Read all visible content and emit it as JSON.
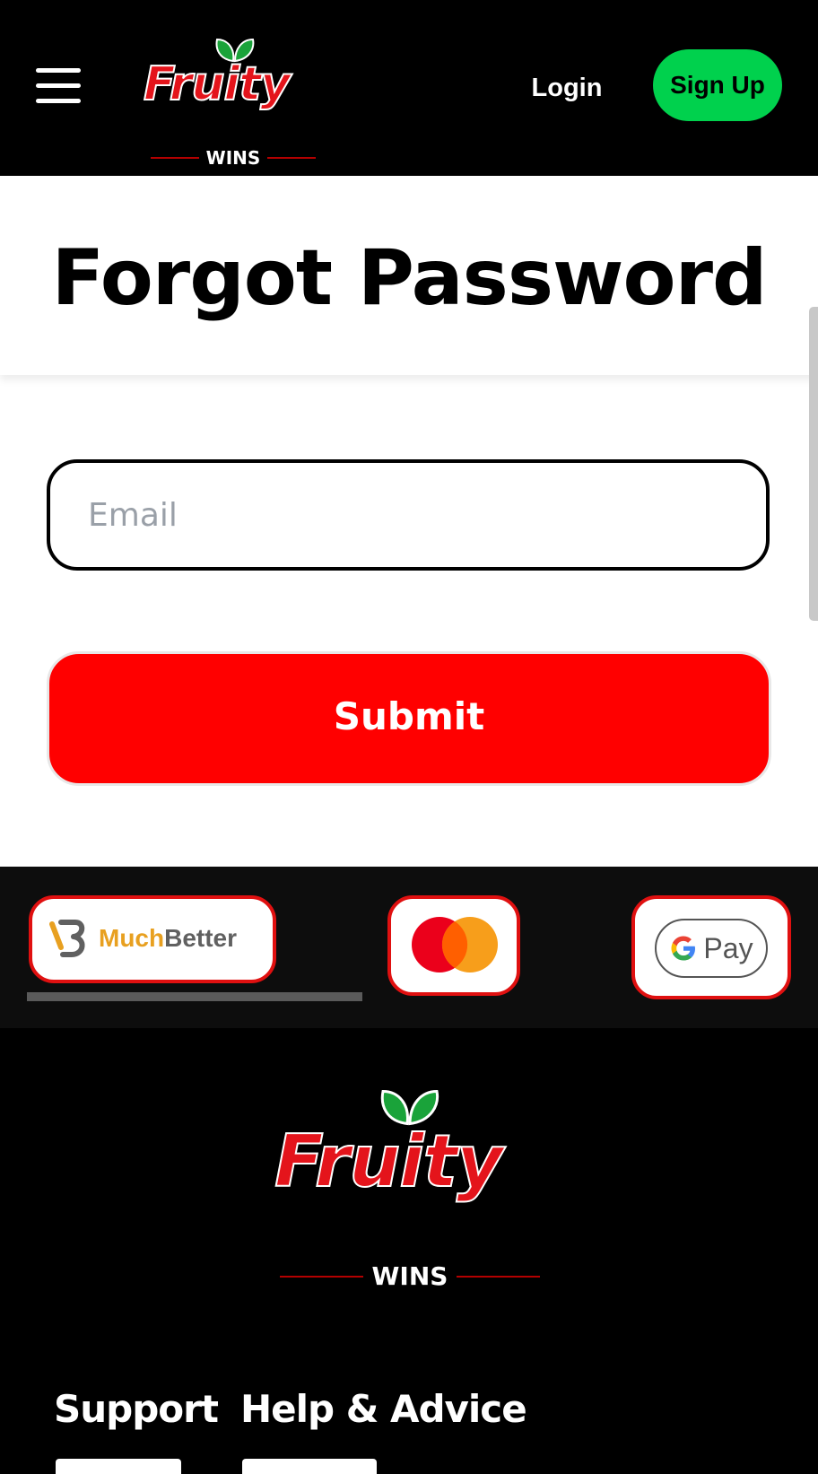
{
  "header": {
    "logo": {
      "word": "Fruity",
      "sub": "WINS"
    },
    "login_label": "Login",
    "signup_label": "Sign Up"
  },
  "main": {
    "title": "Forgot Password",
    "email_placeholder": "Email",
    "email_value": "",
    "submit_label": "Submit"
  },
  "payments": {
    "muchbetter": {
      "part1": "Much",
      "part2": "Better"
    },
    "mastercard": {
      "icon": "mastercard-logo"
    },
    "gpay": {
      "g": "G",
      "label": "Pay"
    }
  },
  "footer": {
    "logo": {
      "word": "Fruity",
      "sub": "WINS"
    },
    "links": [
      {
        "label": "Support"
      },
      {
        "label": "Help & Advice"
      }
    ]
  },
  "colors": {
    "header_bg": "#000000",
    "signup_green": "#00d14d",
    "submit_red": "#ff0000",
    "card_border": "#e01010",
    "brand_red": "#e4141b"
  }
}
